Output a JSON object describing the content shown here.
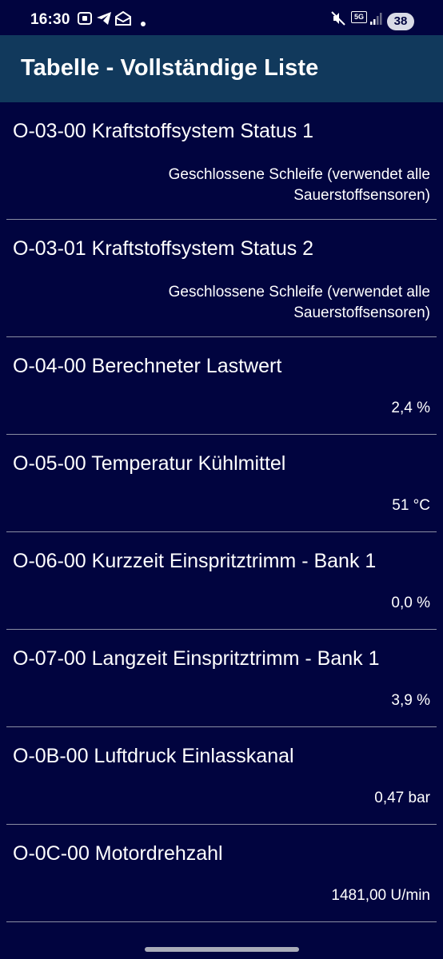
{
  "status_bar": {
    "time": "16:30",
    "network": "5G",
    "battery": "38"
  },
  "app_bar": {
    "title": "Tabelle - Vollständige Liste"
  },
  "rows": [
    {
      "title": "O-03-00 Kraftstoffsystem Status 1",
      "value_line1": "Geschlossene Schleife (verwendet alle",
      "value_line2": "Sauerstoffsensoren)"
    },
    {
      "title": "O-03-01 Kraftstoffsystem Status 2",
      "value_line1": "Geschlossene Schleife (verwendet alle",
      "value_line2": "Sauerstoffsensoren)"
    },
    {
      "title": "O-04-00 Berechneter Lastwert",
      "value": "2,4 %"
    },
    {
      "title": "O-05-00 Temperatur Kühlmittel",
      "value": "51 °C"
    },
    {
      "title": "O-06-00 Kurzzeit Einspritztrimm - Bank 1",
      "value": "0,0 %"
    },
    {
      "title": "O-07-00 Langzeit Einspritztrimm - Bank 1",
      "value": "3,9 %"
    },
    {
      "title": "O-0B-00 Luftdruck Einlasskanal",
      "value": "0,47 bar"
    },
    {
      "title": "O-0C-00 Motordrehzahl",
      "value": "1481,00 U/min"
    }
  ],
  "colors": {
    "background": "#01043f",
    "app_bar": "#11395c",
    "divider": "#8a8ea3"
  }
}
